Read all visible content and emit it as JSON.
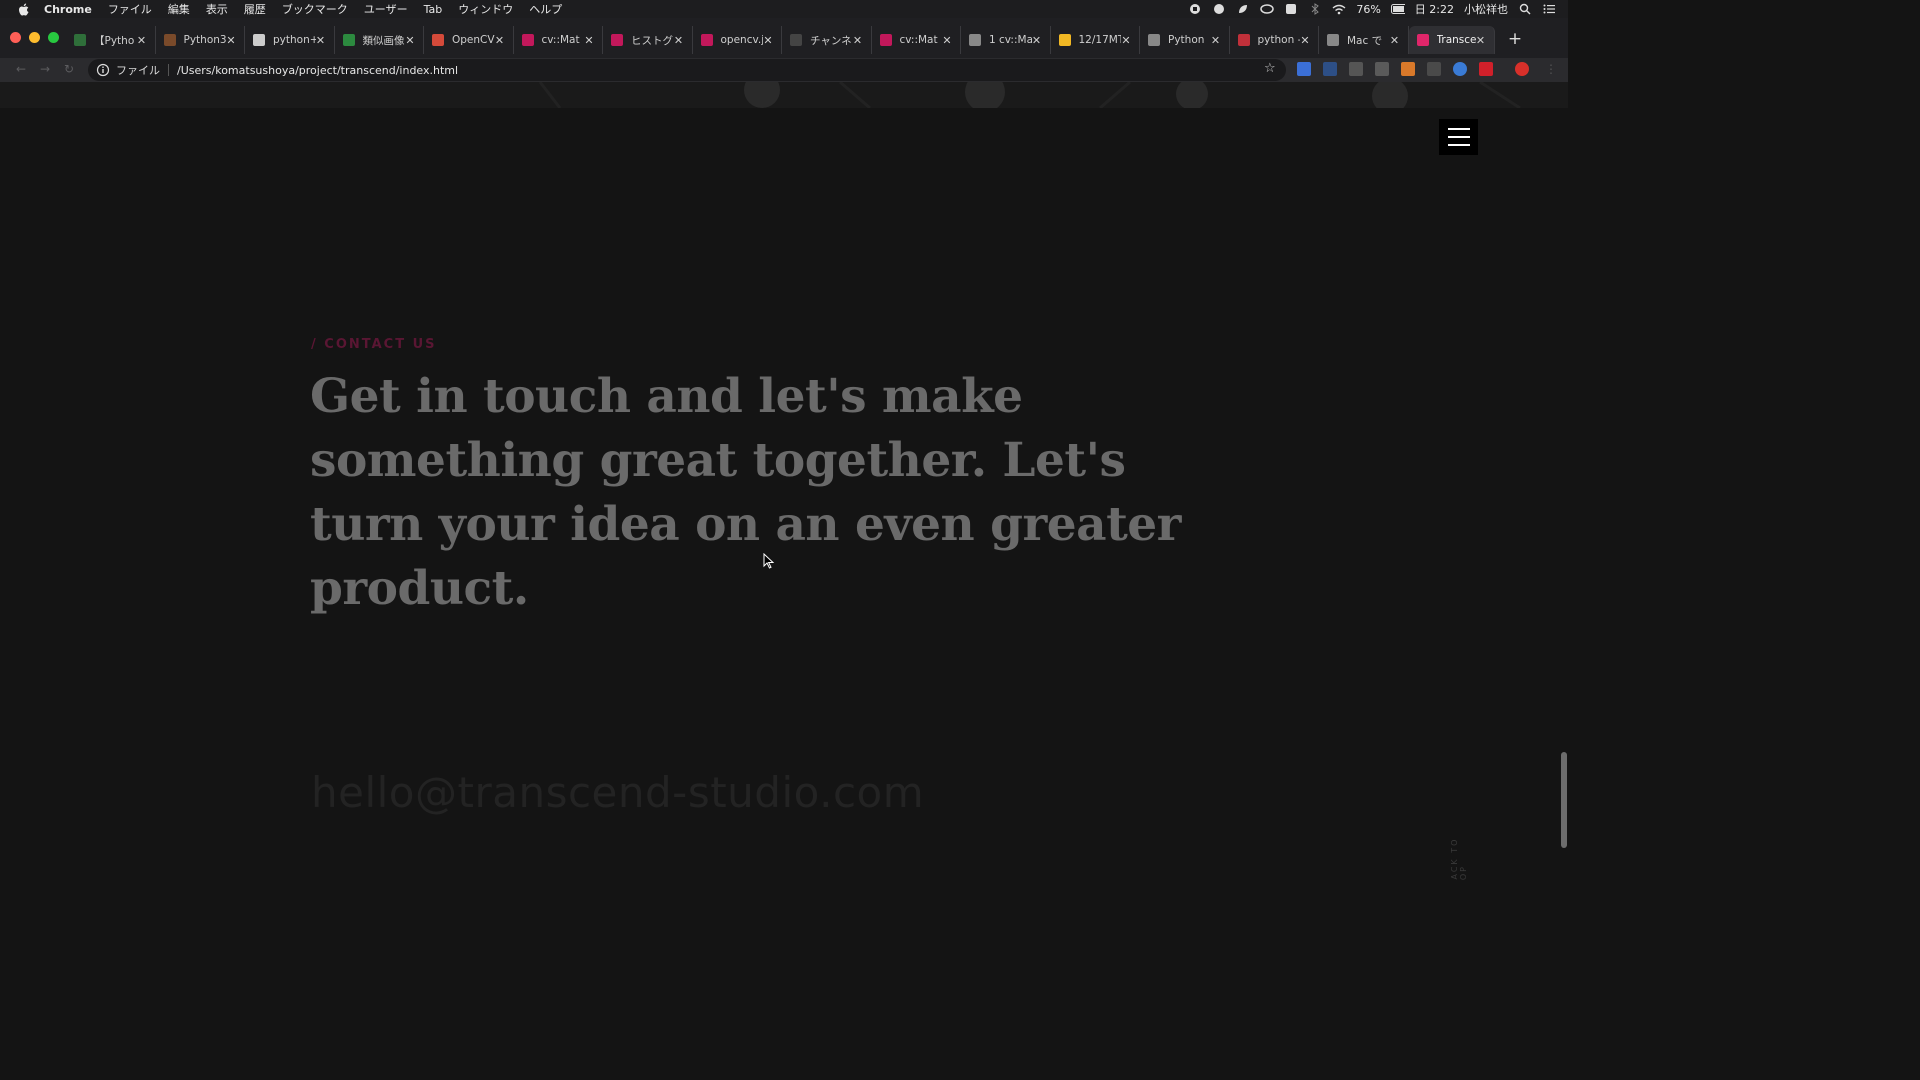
{
  "os_menubar": {
    "app_name": "Chrome",
    "items": [
      "ファイル",
      "編集",
      "表示",
      "履歴",
      "ブックマーク",
      "ユーザー",
      "Tab",
      "ウィンドウ",
      "ヘルプ"
    ],
    "battery": "76%",
    "clock": "日 2:22",
    "user": "小松祥也"
  },
  "tabs": [
    {
      "title": "【Pytho",
      "color": "#2f6f3a"
    },
    {
      "title": "Python3",
      "color": "#7a4a2a"
    },
    {
      "title": "python+",
      "color": "#cccccc"
    },
    {
      "title": "類似画像",
      "color": "#2c8a3f"
    },
    {
      "title": "OpenCV",
      "color": "#d44a3a"
    },
    {
      "title": "cv::Mat",
      "color": "#c2185b"
    },
    {
      "title": "ヒストグ",
      "color": "#c2185b"
    },
    {
      "title": "opencv.j",
      "color": "#c2185b"
    },
    {
      "title": "チャンネ",
      "color": "#444444"
    },
    {
      "title": "cv::Mat",
      "color": "#c2185b"
    },
    {
      "title": "1 cv::Ma",
      "color": "#888888"
    },
    {
      "title": "12/17MT",
      "color": "#f2b824"
    },
    {
      "title": "Python",
      "color": "#888888"
    },
    {
      "title": "python -",
      "color": "#c0303a"
    },
    {
      "title": "Mac で",
      "color": "#888888"
    },
    {
      "title": "Transce",
      "color": "#e0266a"
    }
  ],
  "address_bar": {
    "scheme_label": "ファイル",
    "url": "/Users/komatsushoya/project/transcend/index.html"
  },
  "page": {
    "section_label": "/ CONTACT US",
    "headline": "Get in touch and let's make something great together. Let's turn your idea on an even greater product.",
    "email": "hello@transcend-studio.com",
    "back_to_top": "BACK TO TOP"
  }
}
